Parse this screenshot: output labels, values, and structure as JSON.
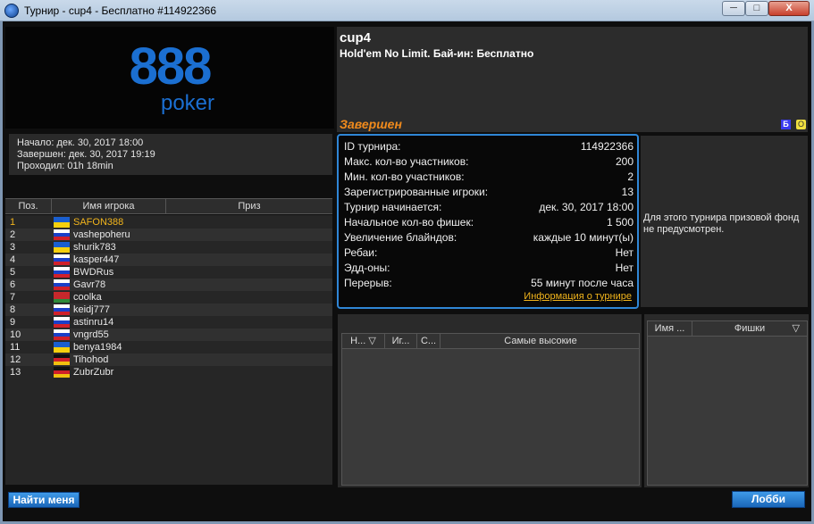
{
  "window": {
    "title": "Турнир - cup4 - Бесплатно #114922366",
    "min": "─",
    "max": "□",
    "close": "X"
  },
  "logo": {
    "number": "888",
    "word": "poker"
  },
  "times": {
    "start": "Начало: дек. 30, 2017 18:00",
    "finish": "Завершен: дек. 30, 2017 19:19",
    "duration": "Проходил: 01h 18min"
  },
  "players_table": {
    "headers": [
      "Поз.",
      "Имя игрока",
      "Приз"
    ],
    "rows": [
      {
        "pos": "1",
        "name": "SAFON388",
        "flag": "ukraine"
      },
      {
        "pos": "2",
        "name": "vashepoheru",
        "flag": "russia"
      },
      {
        "pos": "3",
        "name": "shurik783",
        "flag": "ukraine"
      },
      {
        "pos": "4",
        "name": "kasper447",
        "flag": "russia"
      },
      {
        "pos": "5",
        "name": "BWDRus",
        "flag": "russia"
      },
      {
        "pos": "6",
        "name": "Gavr78",
        "flag": "russia"
      },
      {
        "pos": "7",
        "name": "coolka",
        "flag": "belarus"
      },
      {
        "pos": "8",
        "name": "keidj777",
        "flag": "russia"
      },
      {
        "pos": "9",
        "name": "astinru14",
        "flag": "russia"
      },
      {
        "pos": "10",
        "name": "vngrd55",
        "flag": "russia"
      },
      {
        "pos": "11",
        "name": "benya1984",
        "flag": "ukraine"
      },
      {
        "pos": "12",
        "name": "Tihohod",
        "flag": "germany"
      },
      {
        "pos": "13",
        "name": "ZubrZubr",
        "flag": "germany"
      }
    ]
  },
  "tournament": {
    "name": "cup4",
    "game": "Hold'em No Limit. Бай-ин: Бесплатно",
    "status": "Завершен",
    "icon_b": "Б",
    "icon_o": "O"
  },
  "info": {
    "rows": [
      {
        "label": "ID турнира:",
        "value": "114922366"
      },
      {
        "label": "Макс. кол-во участников:",
        "value": "200"
      },
      {
        "label": "Мин. кол-во участников:",
        "value": "2"
      },
      {
        "label": "Зарегистрированные игроки:",
        "value": "13"
      },
      {
        "label": "Турнир начинается:",
        "value": "дек. 30, 2017 18:00"
      },
      {
        "label": "Начальное кол-во фишек:",
        "value": "1 500"
      },
      {
        "label": "Увеличение блайндов:",
        "value": "каждые 10 минут(ы)"
      },
      {
        "label": "Ребаи:",
        "value": "Нет"
      },
      {
        "label": "Эдд-оны:",
        "value": "Нет"
      },
      {
        "label": "Перерыв:",
        "value": "55 минут после часа"
      }
    ],
    "link": "Информация о турнире"
  },
  "prize_text": "Для этого турнира призовой фонд не предусмотрен.",
  "tables_header": [
    "Н...",
    "Иг...",
    "С...",
    "Самые высокие"
  ],
  "chips_header": [
    "Имя ...",
    "Фишки"
  ],
  "buttons": {
    "find_me": "Найти меня",
    "lobby": "Лобби"
  }
}
